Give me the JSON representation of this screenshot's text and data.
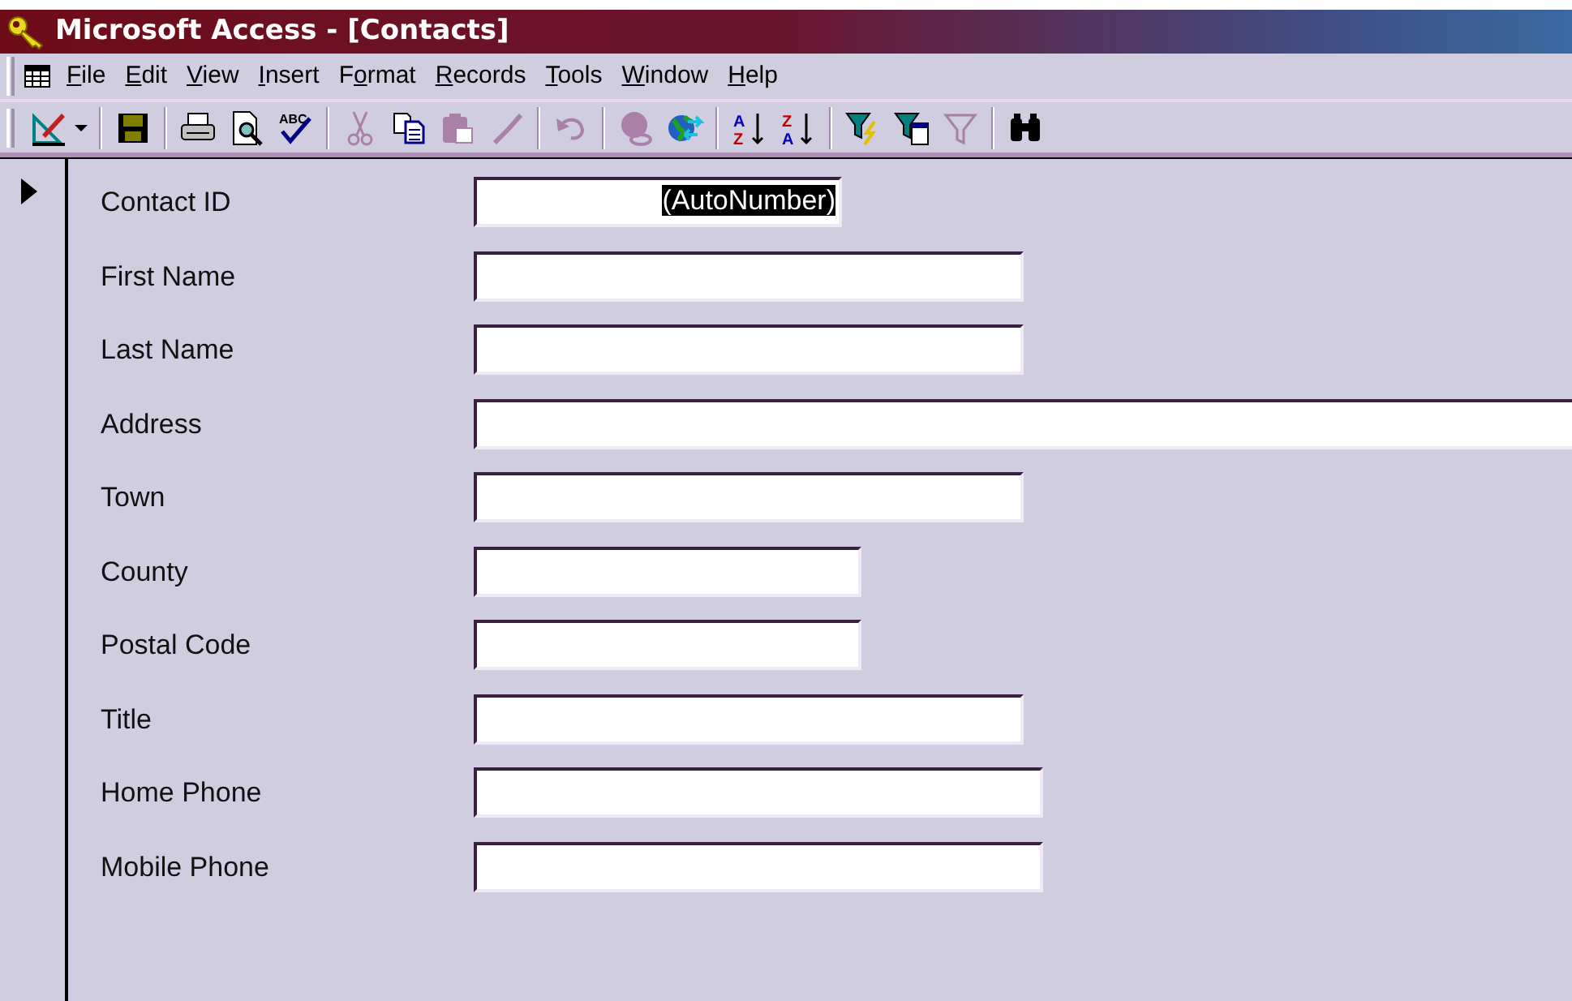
{
  "window": {
    "title": "Microsoft Access - [Contacts]"
  },
  "menu": [
    {
      "key": "F",
      "rest": "ile"
    },
    {
      "key": "E",
      "rest": "dit"
    },
    {
      "key": "V",
      "rest": "iew"
    },
    {
      "key": "I",
      "rest": "nsert"
    },
    {
      "lead": "F",
      "key": "o",
      "rest": "rmat"
    },
    {
      "key": "R",
      "rest": "ecords"
    },
    {
      "key": "T",
      "rest": "ools"
    },
    {
      "key": "W",
      "rest": "indow"
    },
    {
      "key": "H",
      "rest": "elp"
    }
  ],
  "toolbar": {
    "groups": [
      [
        {
          "kind": "design",
          "disabled": false
        }
      ],
      [
        {
          "kind": "save",
          "disabled": false
        }
      ],
      [
        {
          "kind": "print",
          "disabled": false
        },
        {
          "kind": "preview",
          "disabled": false
        },
        {
          "kind": "spelling",
          "disabled": false,
          "letters": [
            "ABC"
          ]
        }
      ],
      [
        {
          "kind": "cut",
          "disabled": true
        },
        {
          "kind": "copy",
          "disabled": false
        },
        {
          "kind": "paste",
          "disabled": true
        },
        {
          "kind": "painter",
          "disabled": true
        }
      ],
      [
        {
          "kind": "undo",
          "disabled": true
        }
      ],
      [
        {
          "kind": "hyperlink",
          "disabled": true
        },
        {
          "kind": "web",
          "disabled": false
        }
      ],
      [
        {
          "kind": "sortasc",
          "disabled": false,
          "letters": [
            "A",
            "Z"
          ]
        },
        {
          "kind": "sortdesc",
          "disabled": false,
          "letters": [
            "Z",
            "A"
          ]
        }
      ],
      [
        {
          "kind": "filtersel",
          "disabled": false
        },
        {
          "kind": "filterform",
          "disabled": false
        },
        {
          "kind": "applyfilter",
          "disabled": true
        }
      ],
      [
        {
          "kind": "find",
          "disabled": false
        }
      ]
    ]
  },
  "record_selector": {
    "current": true
  },
  "fields": [
    {
      "label": "Contact ID",
      "value": "(AutoNumber)",
      "selected": true,
      "kind": "medium"
    },
    {
      "label": "First Name",
      "selected": false,
      "kind": "long"
    },
    {
      "label": "Last Name",
      "selected": false,
      "kind": "long"
    },
    {
      "label": "Address",
      "selected": false,
      "kind": "full"
    },
    {
      "label": "Town",
      "selected": false,
      "kind": "long"
    },
    {
      "label": "County",
      "selected": false,
      "kind": "short"
    },
    {
      "label": "Postal Code",
      "selected": false,
      "kind": "short"
    },
    {
      "label": "Title",
      "selected": false,
      "kind": "long"
    },
    {
      "label": "Home Phone",
      "selected": false,
      "kind": "wide"
    },
    {
      "label": "Mobile Phone",
      "selected": false,
      "kind": "wide"
    }
  ]
}
